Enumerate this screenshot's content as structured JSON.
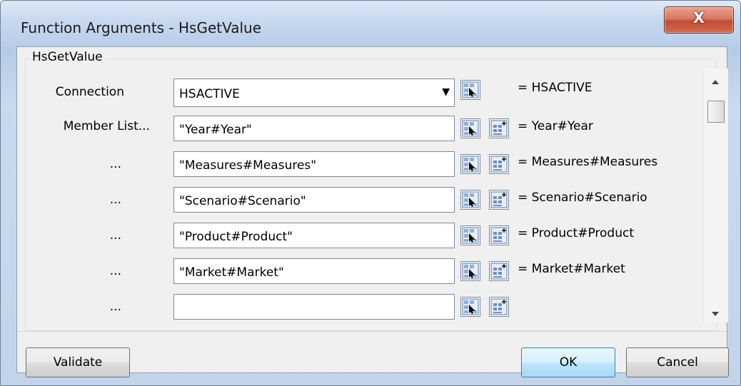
{
  "window": {
    "title": "Function Arguments - HsGetValue",
    "close_label": "X"
  },
  "group": {
    "label": "HsGetValue"
  },
  "rows": [
    {
      "label": "Connection",
      "value": "HSACTIVE",
      "result": "= HSACTIVE",
      "type": "dropdown"
    },
    {
      "label": "Member List...",
      "value": "\"Year#Year\"",
      "result": "= Year#Year",
      "type": "text"
    },
    {
      "label": "...",
      "value": "\"Measures#Measures\"",
      "result": "= Measures#Measures",
      "type": "text"
    },
    {
      "label": "...",
      "value": "\"Scenario#Scenario\"",
      "result": "= Scenario#Scenario",
      "type": "text"
    },
    {
      "label": "...",
      "value": "\"Product#Product\"",
      "result": "= Product#Product",
      "type": "text"
    },
    {
      "label": "...",
      "value": "\"Market#Market\"",
      "result": "= Market#Market",
      "type": "text"
    },
    {
      "label": "...",
      "value": "",
      "result": "",
      "type": "text"
    }
  ],
  "buttons": {
    "validate": "Validate",
    "ok": "OK",
    "cancel": "Cancel"
  },
  "icons": {
    "close": "close-icon",
    "pick": "cell-picker-icon",
    "member": "member-selector-icon",
    "dropdown": "chevron-down-icon"
  }
}
